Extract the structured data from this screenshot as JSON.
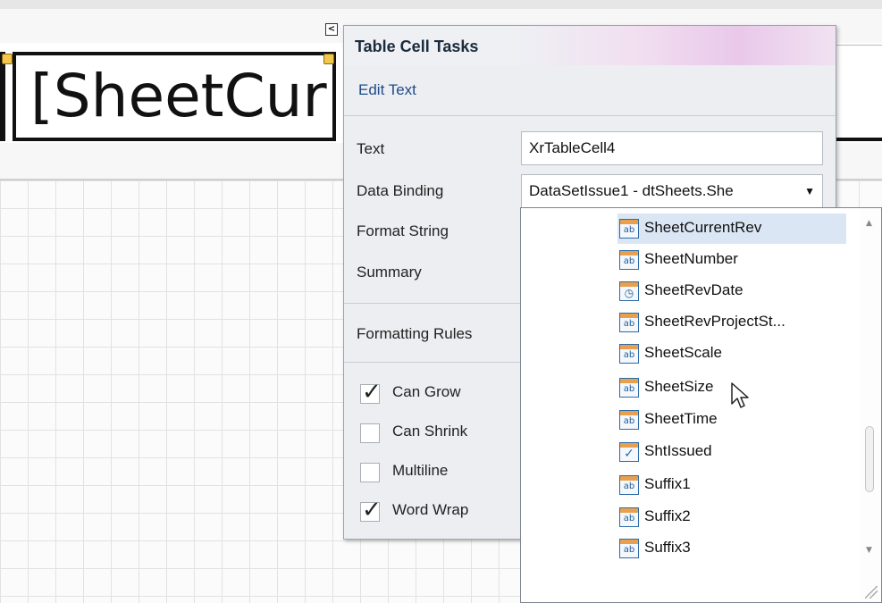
{
  "designer": {
    "cell_text": "[SheetCur",
    "smart_tag_glyph": "<"
  },
  "panel": {
    "title": "Table Cell Tasks",
    "edit_text_link": "Edit Text",
    "fields": {
      "text_label": "Text",
      "text_value": "XrTableCell4",
      "data_binding_label": "Data Binding",
      "data_binding_value": "DataSetIssue1 - dtSheets.She",
      "format_string_label": "Format String",
      "summary_label": "Summary",
      "formatting_rules_label": "Formatting Rules"
    },
    "checkboxes": [
      {
        "label": "Can Grow",
        "checked": true
      },
      {
        "label": "Can Shrink",
        "checked": false
      },
      {
        "label": "Multiline",
        "checked": false
      },
      {
        "label": "Word Wrap",
        "checked": true
      }
    ]
  },
  "dropdown": {
    "selected": "SheetCurrentRev",
    "items": [
      {
        "label": "SheetCurrentRev",
        "icon": "text-field-icon",
        "glyph": "ab"
      },
      {
        "label": "SheetNumber",
        "icon": "text-field-icon",
        "glyph": "ab"
      },
      {
        "label": "SheetRevDate",
        "icon": "datetime-field-icon",
        "glyph": "◷"
      },
      {
        "label": "SheetRevProjectSt...",
        "icon": "text-field-icon",
        "glyph": "ab"
      },
      {
        "label": "SheetScale",
        "icon": "text-field-icon",
        "glyph": "ab"
      },
      {
        "label": "SheetSize",
        "icon": "text-field-icon",
        "glyph": "ab"
      },
      {
        "label": "SheetTime",
        "icon": "text-field-icon",
        "glyph": "ab"
      },
      {
        "label": "ShtIssued",
        "icon": "boolean-field-icon",
        "glyph": "✓"
      },
      {
        "label": "Suffix1",
        "icon": "text-field-icon",
        "glyph": "ab"
      },
      {
        "label": "Suffix2",
        "icon": "text-field-icon",
        "glyph": "ab"
      },
      {
        "label": "Suffix3",
        "icon": "text-field-icon",
        "glyph": "ab"
      }
    ]
  },
  "colors": {
    "link": "#1f4a8a",
    "icon_border": "#2d6aa8",
    "icon_band": "#e9a04d",
    "selection": "#dbe6f5"
  }
}
